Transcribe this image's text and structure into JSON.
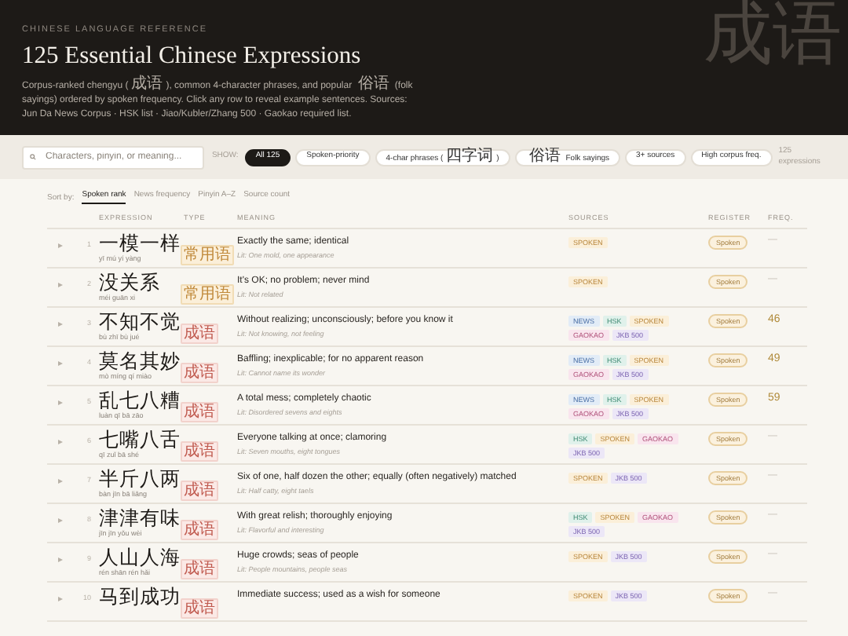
{
  "header": {
    "eyebrow": "CHINESE LANGUAGE REFERENCE",
    "title": "125 Essential Chinese Expressions",
    "glyph": "成语",
    "description": "Corpus-ranked chengyu (成语), common 4-character phrases, and popular 俗语 (folk sayings) ordered by spoken frequency. Click any row to reveal example sentences. Sources: Jun Da News Corpus · HSK list · Jiao/Kubler/Zhang 500 · Gaokao required list."
  },
  "filter_bar": {
    "search": {
      "placeholder": "Characters, pinyin, or meaning..."
    },
    "show_label": "SHOW:",
    "chips": [
      {
        "label": "All 125",
        "selected": true
      },
      {
        "label": "Spoken-priority",
        "selected": false
      },
      {
        "label": "4-char phrases (四字词)",
        "selected": false
      },
      {
        "label": "俗语 Folk sayings",
        "selected": false
      },
      {
        "label": "3+ sources",
        "selected": false
      },
      {
        "label": "High corpus freq.",
        "selected": false
      }
    ],
    "count": "125 expressions"
  },
  "sort": {
    "label": "Sort by:",
    "options": [
      {
        "label": "Spoken rank",
        "selected": true
      },
      {
        "label": "News frequency",
        "selected": false
      },
      {
        "label": "Pinyin A–Z",
        "selected": false
      },
      {
        "label": "Source count",
        "selected": false
      }
    ]
  },
  "table": {
    "columns": [
      "EXPRESSION",
      "TYPE",
      "MEANING",
      "SOURCES",
      "REGISTER",
      "FREQ."
    ],
    "rows": [
      {
        "rank": "1",
        "expression": "一模一样",
        "pinyin": "yī mú yí yàng",
        "type": {
          "label": "常用语",
          "kind": "common"
        },
        "meaning": "Exactly the same; identical",
        "literal": "Lit: One mold, one appearance",
        "sources": [
          {
            "label": "SPOKEN",
            "kind": "spoken"
          }
        ],
        "register": "Spoken",
        "freq": "—"
      },
      {
        "rank": "2",
        "expression": "没关系",
        "pinyin": "méi guān xi",
        "type": {
          "label": "常用语",
          "kind": "common"
        },
        "meaning": "It's OK; no problem; never mind",
        "literal": "Lit: Not related",
        "sources": [
          {
            "label": "SPOKEN",
            "kind": "spoken"
          }
        ],
        "register": "Spoken",
        "freq": "—"
      },
      {
        "rank": "3",
        "expression": "不知不觉",
        "pinyin": "bù zhī bù jué",
        "type": {
          "label": "成语",
          "kind": "chengyu"
        },
        "meaning": "Without realizing; unconsciously; before you know it",
        "literal": "Lit: Not knowing, not feeling",
        "sources": [
          {
            "label": "NEWS",
            "kind": "news"
          },
          {
            "label": "HSK",
            "kind": "hsk"
          },
          {
            "label": "SPOKEN",
            "kind": "spoken"
          },
          {
            "label": "GAOKAO",
            "kind": "gaokao"
          },
          {
            "label": "JKB 500",
            "kind": "jkb"
          }
        ],
        "register": "Spoken",
        "freq": "46"
      },
      {
        "rank": "4",
        "expression": "莫名其妙",
        "pinyin": "mò míng qí miào",
        "type": {
          "label": "成语",
          "kind": "chengyu"
        },
        "meaning": "Baffling; inexplicable; for no apparent reason",
        "literal": "Lit: Cannot name its wonder",
        "sources": [
          {
            "label": "NEWS",
            "kind": "news"
          },
          {
            "label": "HSK",
            "kind": "hsk"
          },
          {
            "label": "SPOKEN",
            "kind": "spoken"
          },
          {
            "label": "GAOKAO",
            "kind": "gaokao"
          },
          {
            "label": "JKB 500",
            "kind": "jkb"
          }
        ],
        "register": "Spoken",
        "freq": "49"
      },
      {
        "rank": "5",
        "expression": "乱七八糟",
        "pinyin": "luàn qī bā zāo",
        "type": {
          "label": "成语",
          "kind": "chengyu"
        },
        "meaning": "A total mess; completely chaotic",
        "literal": "Lit: Disordered sevens and eights",
        "sources": [
          {
            "label": "NEWS",
            "kind": "news"
          },
          {
            "label": "HSK",
            "kind": "hsk"
          },
          {
            "label": "SPOKEN",
            "kind": "spoken"
          },
          {
            "label": "GAOKAO",
            "kind": "gaokao"
          },
          {
            "label": "JKB 500",
            "kind": "jkb"
          }
        ],
        "register": "Spoken",
        "freq": "59"
      },
      {
        "rank": "6",
        "expression": "七嘴八舌",
        "pinyin": "qī zuǐ bā shé",
        "type": {
          "label": "成语",
          "kind": "chengyu"
        },
        "meaning": "Everyone talking at once; clamoring",
        "literal": "Lit: Seven mouths, eight tongues",
        "sources": [
          {
            "label": "HSK",
            "kind": "hsk"
          },
          {
            "label": "SPOKEN",
            "kind": "spoken"
          },
          {
            "label": "GAOKAO",
            "kind": "gaokao"
          },
          {
            "label": "JKB 500",
            "kind": "jkb"
          }
        ],
        "register": "Spoken",
        "freq": "—"
      },
      {
        "rank": "7",
        "expression": "半斤八两",
        "pinyin": "bàn jīn bā liǎng",
        "type": {
          "label": "成语",
          "kind": "chengyu"
        },
        "meaning": "Six of one, half dozen the other; equally (often negatively) matched",
        "literal": "Lit: Half catty, eight taels",
        "sources": [
          {
            "label": "SPOKEN",
            "kind": "spoken"
          },
          {
            "label": "JKB 500",
            "kind": "jkb"
          }
        ],
        "register": "Spoken",
        "freq": "—"
      },
      {
        "rank": "8",
        "expression": "津津有味",
        "pinyin": "jīn jīn yǒu wèi",
        "type": {
          "label": "成语",
          "kind": "chengyu"
        },
        "meaning": "With great relish; thoroughly enjoying",
        "literal": "Lit: Flavorful and interesting",
        "sources": [
          {
            "label": "HSK",
            "kind": "hsk"
          },
          {
            "label": "SPOKEN",
            "kind": "spoken"
          },
          {
            "label": "GAOKAO",
            "kind": "gaokao"
          },
          {
            "label": "JKB 500",
            "kind": "jkb"
          }
        ],
        "register": "Spoken",
        "freq": "—"
      },
      {
        "rank": "9",
        "expression": "人山人海",
        "pinyin": "rén shān rén hǎi",
        "type": {
          "label": "成语",
          "kind": "chengyu"
        },
        "meaning": "Huge crowds; seas of people",
        "literal": "Lit: People mountains, people seas",
        "sources": [
          {
            "label": "SPOKEN",
            "kind": "spoken"
          },
          {
            "label": "JKB 500",
            "kind": "jkb"
          }
        ],
        "register": "Spoken",
        "freq": "—"
      },
      {
        "rank": "10",
        "expression": "马到成功",
        "type": {
          "label": "成语",
          "kind": "chengyu"
        },
        "meaning": "Immediate success; used as a wish for someone",
        "sources": [
          {
            "label": "SPOKEN",
            "kind": "spoken"
          },
          {
            "label": "JKB 500",
            "kind": "jkb"
          }
        ],
        "register": "Spoken",
        "freq": "—"
      }
    ]
  }
}
